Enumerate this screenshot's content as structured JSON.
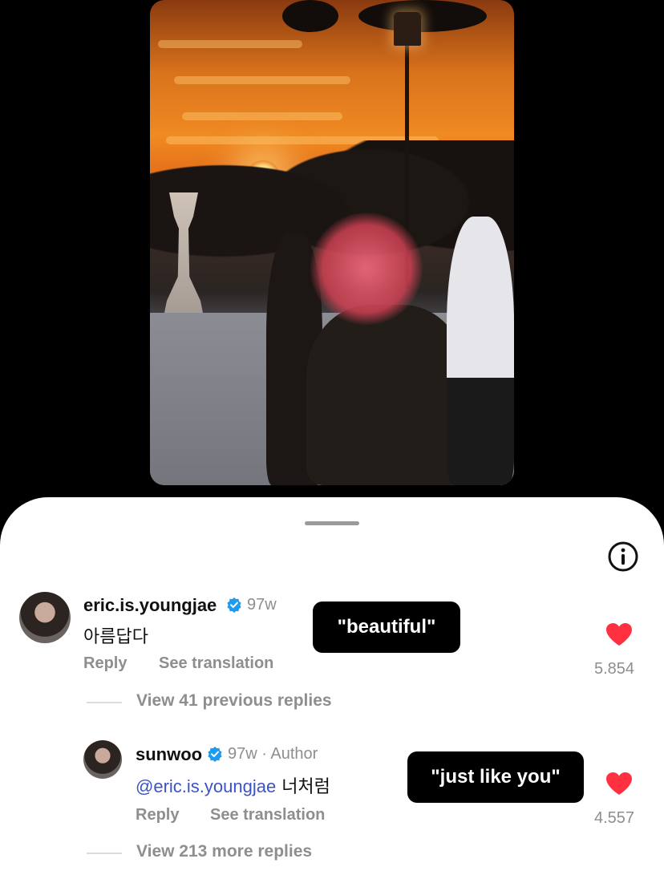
{
  "comments": [
    {
      "username": "eric.is.youngjae",
      "time": "97w",
      "text": "아름답다",
      "reply_label": "Reply",
      "translate_label": "See translation",
      "likes": "5.854",
      "caption": "\"beautiful\""
    },
    {
      "username": "sunwoo",
      "time": "97w · Author",
      "mention": "@eric.is.youngjae",
      "text": " 너처럼",
      "reply_label": "Reply",
      "translate_label": "See translation",
      "likes": "4.557",
      "caption": "\"just like you\""
    }
  ],
  "view_previous": "View 41 previous replies",
  "view_more": "View 213 more replies",
  "colors": {
    "heart": "#ff3040",
    "verified": "#1d9bf0",
    "mention": "#3a53c8"
  },
  "icons": [
    "info-icon",
    "verified-badge-icon",
    "heart-icon"
  ]
}
